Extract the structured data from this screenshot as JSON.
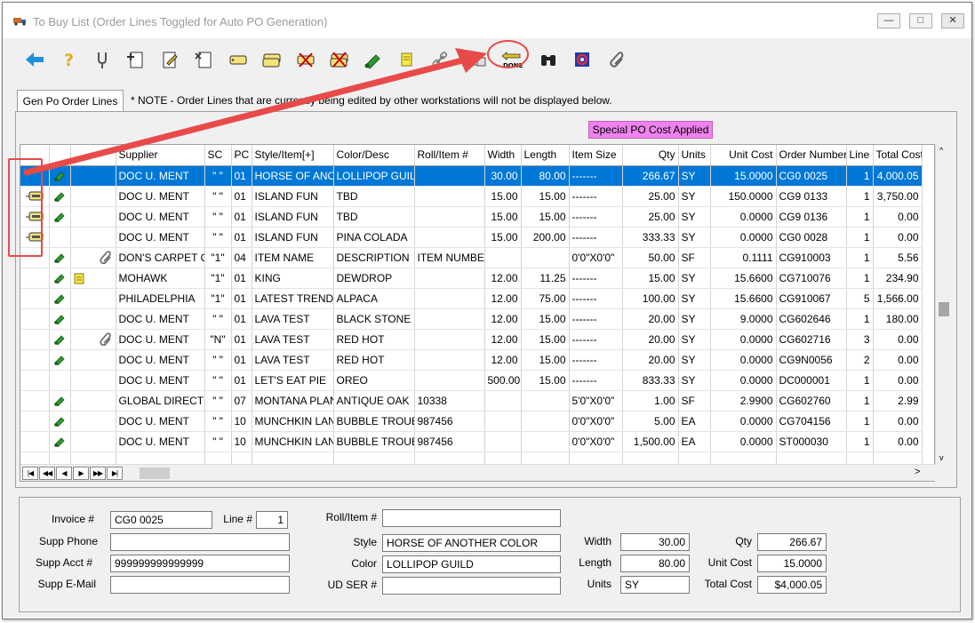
{
  "window": {
    "title": "To Buy List  (Order Lines Toggled for Auto PO Generation)",
    "minimize_glyph": "—",
    "maximize_glyph": "□",
    "close_glyph": "✕"
  },
  "toolbar": {
    "buttons": [
      {
        "icon": "back-arrow-icon"
      },
      {
        "icon": "help-question-icon"
      },
      {
        "icon": "tuning-fork-icon"
      },
      {
        "icon": "add-document-icon"
      },
      {
        "icon": "edit-document-icon"
      },
      {
        "icon": "delete-document-icon"
      },
      {
        "icon": "tag-icon"
      },
      {
        "icon": "tag-stack-icon"
      },
      {
        "icon": "tag-remove-icon"
      },
      {
        "icon": "tag-multi-remove-icon"
      },
      {
        "icon": "green-roll-icon"
      },
      {
        "icon": "note-icon"
      },
      {
        "icon": "link-icon"
      },
      {
        "icon": "grid-tags-icon"
      },
      {
        "icon": "done-icon",
        "label": "DONE"
      },
      {
        "icon": "binoculars-icon"
      },
      {
        "icon": "refresh-icon"
      },
      {
        "icon": "paperclip-icon"
      }
    ]
  },
  "tabs": [
    {
      "label": "Gen Po Order Lines"
    }
  ],
  "note": "* NOTE - Order Lines that are currently being edited by other workstations will not be displayed below.",
  "special_badge": "Special PO Cost Applied",
  "grid": {
    "columns": [
      "",
      "",
      "",
      "Supplier",
      "SC",
      "PC",
      "Style/Item[+]",
      "Color/Desc",
      "Roll/Item #",
      "Width",
      "Length",
      "Item Size",
      "Qty",
      "Units",
      "Unit Cost",
      "Order Number",
      "Line",
      "Total Cost"
    ],
    "rows": [
      {
        "tag": false,
        "roll": true,
        "extra": "",
        "supplier": "DOC U. MENT",
        "sc": "\" \"",
        "pc": "01",
        "style": "HORSE OF ANOTHER COLOR",
        "color": "LOLLIPOP GUILD",
        "rollitem": "",
        "width": "30.00",
        "length": "80.00",
        "itemsize": "-------",
        "qty": "266.67",
        "units": "SY",
        "unitcost": "15.0000",
        "order": "CG0 0025",
        "line": "1",
        "total": "4,000.05",
        "selected": true
      },
      {
        "tag": true,
        "roll": true,
        "extra": "",
        "supplier": "DOC U. MENT",
        "sc": "\" \"",
        "pc": "01",
        "style": "ISLAND FUN",
        "color": "TBD",
        "rollitem": "",
        "width": "15.00",
        "length": "15.00",
        "itemsize": "-------",
        "qty": "25.00",
        "units": "SY",
        "unitcost": "150.0000",
        "order": "CG9 0133",
        "line": "1",
        "total": "3,750.00"
      },
      {
        "tag": true,
        "roll": true,
        "extra": "",
        "supplier": "DOC U. MENT",
        "sc": "\" \"",
        "pc": "01",
        "style": "ISLAND FUN",
        "color": "TBD",
        "rollitem": "",
        "width": "15.00",
        "length": "15.00",
        "itemsize": "-------",
        "qty": "25.00",
        "units": "SY",
        "unitcost": "0.0000",
        "order": "CG9 0136",
        "line": "1",
        "total": "0.00"
      },
      {
        "tag": true,
        "roll": false,
        "extra": "",
        "supplier": "DOC U. MENT",
        "sc": "\" \"",
        "pc": "01",
        "style": "ISLAND FUN",
        "color": "PINA COLADA",
        "rollitem": "",
        "width": "15.00",
        "length": "200.00",
        "itemsize": "-------",
        "qty": "333.33",
        "units": "SY",
        "unitcost": "0.0000",
        "order": "CG0 0028",
        "line": "1",
        "total": "0.00"
      },
      {
        "tag": false,
        "roll": true,
        "extra": "clip",
        "supplier": "DON'S CARPET OUTLET",
        "sc": "\"1\"",
        "pc": "04",
        "style": "ITEM NAME",
        "color": "DESCRIPTION",
        "rollitem": "ITEM NUMBER",
        "width": "",
        "length": "",
        "itemsize": "0'0\"X0'0\"",
        "qty": "50.00",
        "units": "SF",
        "unitcost": "0.1111",
        "order": "CG910003",
        "line": "1",
        "total": "5.56"
      },
      {
        "tag": false,
        "roll": true,
        "extra": "note",
        "supplier": "MOHAWK",
        "sc": "\"1\"",
        "pc": "01",
        "style": "KING",
        "color": "DEWDROP",
        "rollitem": "",
        "width": "12.00",
        "length": "11.25",
        "itemsize": "-------",
        "qty": "15.00",
        "units": "SY",
        "unitcost": "15.6600",
        "order": "CG710076",
        "line": "1",
        "total": "234.90"
      },
      {
        "tag": false,
        "roll": true,
        "extra": "",
        "supplier": "PHILADELPHIA",
        "sc": "\"1\"",
        "pc": "01",
        "style": "LATEST TREND",
        "color": "ALPACA",
        "rollitem": "",
        "width": "12.00",
        "length": "75.00",
        "itemsize": "-------",
        "qty": "100.00",
        "units": "SY",
        "unitcost": "15.6600",
        "order": "CG910067",
        "line": "5",
        "total": "1,566.00"
      },
      {
        "tag": false,
        "roll": true,
        "extra": "",
        "supplier": "DOC U. MENT",
        "sc": "\" \"",
        "pc": "01",
        "style": "LAVA TEST",
        "color": "BLACK STONE",
        "rollitem": "",
        "width": "12.00",
        "length": "15.00",
        "itemsize": "-------",
        "qty": "20.00",
        "units": "SY",
        "unitcost": "9.0000",
        "order": "CG602646",
        "line": "1",
        "total": "180.00"
      },
      {
        "tag": false,
        "roll": true,
        "extra": "clip",
        "supplier": "DOC U. MENT",
        "sc": "\"N\"",
        "pc": "01",
        "style": "LAVA TEST",
        "color": "RED HOT",
        "rollitem": "",
        "width": "12.00",
        "length": "15.00",
        "itemsize": "-------",
        "qty": "20.00",
        "units": "SY",
        "unitcost": "0.0000",
        "order": "CG602716",
        "line": "3",
        "total": "0.00"
      },
      {
        "tag": false,
        "roll": true,
        "extra": "",
        "supplier": "DOC U. MENT",
        "sc": "\" \"",
        "pc": "01",
        "style": "LAVA TEST",
        "color": "RED HOT",
        "rollitem": "",
        "width": "12.00",
        "length": "15.00",
        "itemsize": "-------",
        "qty": "20.00",
        "units": "SY",
        "unitcost": "0.0000",
        "order": "CG9N0056",
        "line": "2",
        "total": "0.00"
      },
      {
        "tag": false,
        "roll": false,
        "extra": "",
        "supplier": "DOC U. MENT",
        "sc": "\" \"",
        "pc": "01",
        "style": "LET'S EAT PIE",
        "color": "OREO",
        "rollitem": "",
        "width": "500.00",
        "length": "15.00",
        "itemsize": "-------",
        "qty": "833.33",
        "units": "SY",
        "unitcost": "0.0000",
        "order": "DC000001",
        "line": "1",
        "total": "0.00"
      },
      {
        "tag": false,
        "roll": true,
        "extra": "",
        "supplier": "GLOBAL DIRECT",
        "sc": "\" \"",
        "pc": "07",
        "style": "MONTANA PLANK",
        "color": "ANTIQUE OAK",
        "rollitem": "10338",
        "width": "",
        "length": "",
        "itemsize": "5'0\"X0'0\"",
        "qty": "1.00",
        "units": "SF",
        "unitcost": "2.9900",
        "order": "CG602760",
        "line": "1",
        "total": "2.99"
      },
      {
        "tag": false,
        "roll": true,
        "extra": "",
        "supplier": "DOC U. MENT",
        "sc": "\" \"",
        "pc": "10",
        "style": "MUNCHKIN LAND",
        "color": "BUBBLE TROUBLE",
        "rollitem": "987456",
        "width": "",
        "length": "",
        "itemsize": "0'0\"X0'0\"",
        "qty": "5.00",
        "units": "EA",
        "unitcost": "0.0000",
        "order": "CG704156",
        "line": "1",
        "total": "0.00"
      },
      {
        "tag": false,
        "roll": true,
        "extra": "",
        "supplier": "DOC U. MENT",
        "sc": "\" \"",
        "pc": "10",
        "style": "MUNCHKIN LAND",
        "color": "BUBBLE TROUBLE",
        "rollitem": "987456",
        "width": "",
        "length": "",
        "itemsize": "0'0\"X0'0\"",
        "qty": "1,500.00",
        "units": "EA",
        "unitcost": "0.0000",
        "order": "ST000030",
        "line": "1",
        "total": "0.00"
      }
    ],
    "nav": [
      "|◀",
      "◀◀",
      "◀",
      "▶",
      "▶▶",
      "▶|"
    ]
  },
  "detail": {
    "invoice_label": "Invoice #",
    "invoice_value": "CG0 0025",
    "line_label": "Line #",
    "line_value": "1",
    "supp_phone_label": "Supp Phone",
    "supp_phone_value": "",
    "supp_acct_label": "Supp Acct #",
    "supp_acct_value": "999999999999999",
    "supp_email_label": "Supp E-Mail",
    "supp_email_value": "",
    "roll_item_label": "Roll/Item #",
    "roll_item_value": "",
    "style_label": "Style",
    "style_value": "HORSE OF ANOTHER COLOR",
    "color_label": "Color",
    "color_value": "LOLLIPOP GUILD",
    "ud_ser_label": "UD SER #",
    "ud_ser_value": "",
    "width_label": "Width",
    "width_value": "30.00",
    "length_label": "Length",
    "length_value": "80.00",
    "units_label": "Units",
    "units_value": "SY",
    "qty_label": "Qty",
    "qty_value": "266.67",
    "unit_cost_label": "Unit Cost",
    "unit_cost_value": "15.0000",
    "total_cost_label": "Total Cost",
    "total_cost_value": "$4,000.05"
  },
  "colors": {
    "selection": "#0078d7",
    "annotation": "#e84a4a",
    "badge": "#ee82ee"
  }
}
